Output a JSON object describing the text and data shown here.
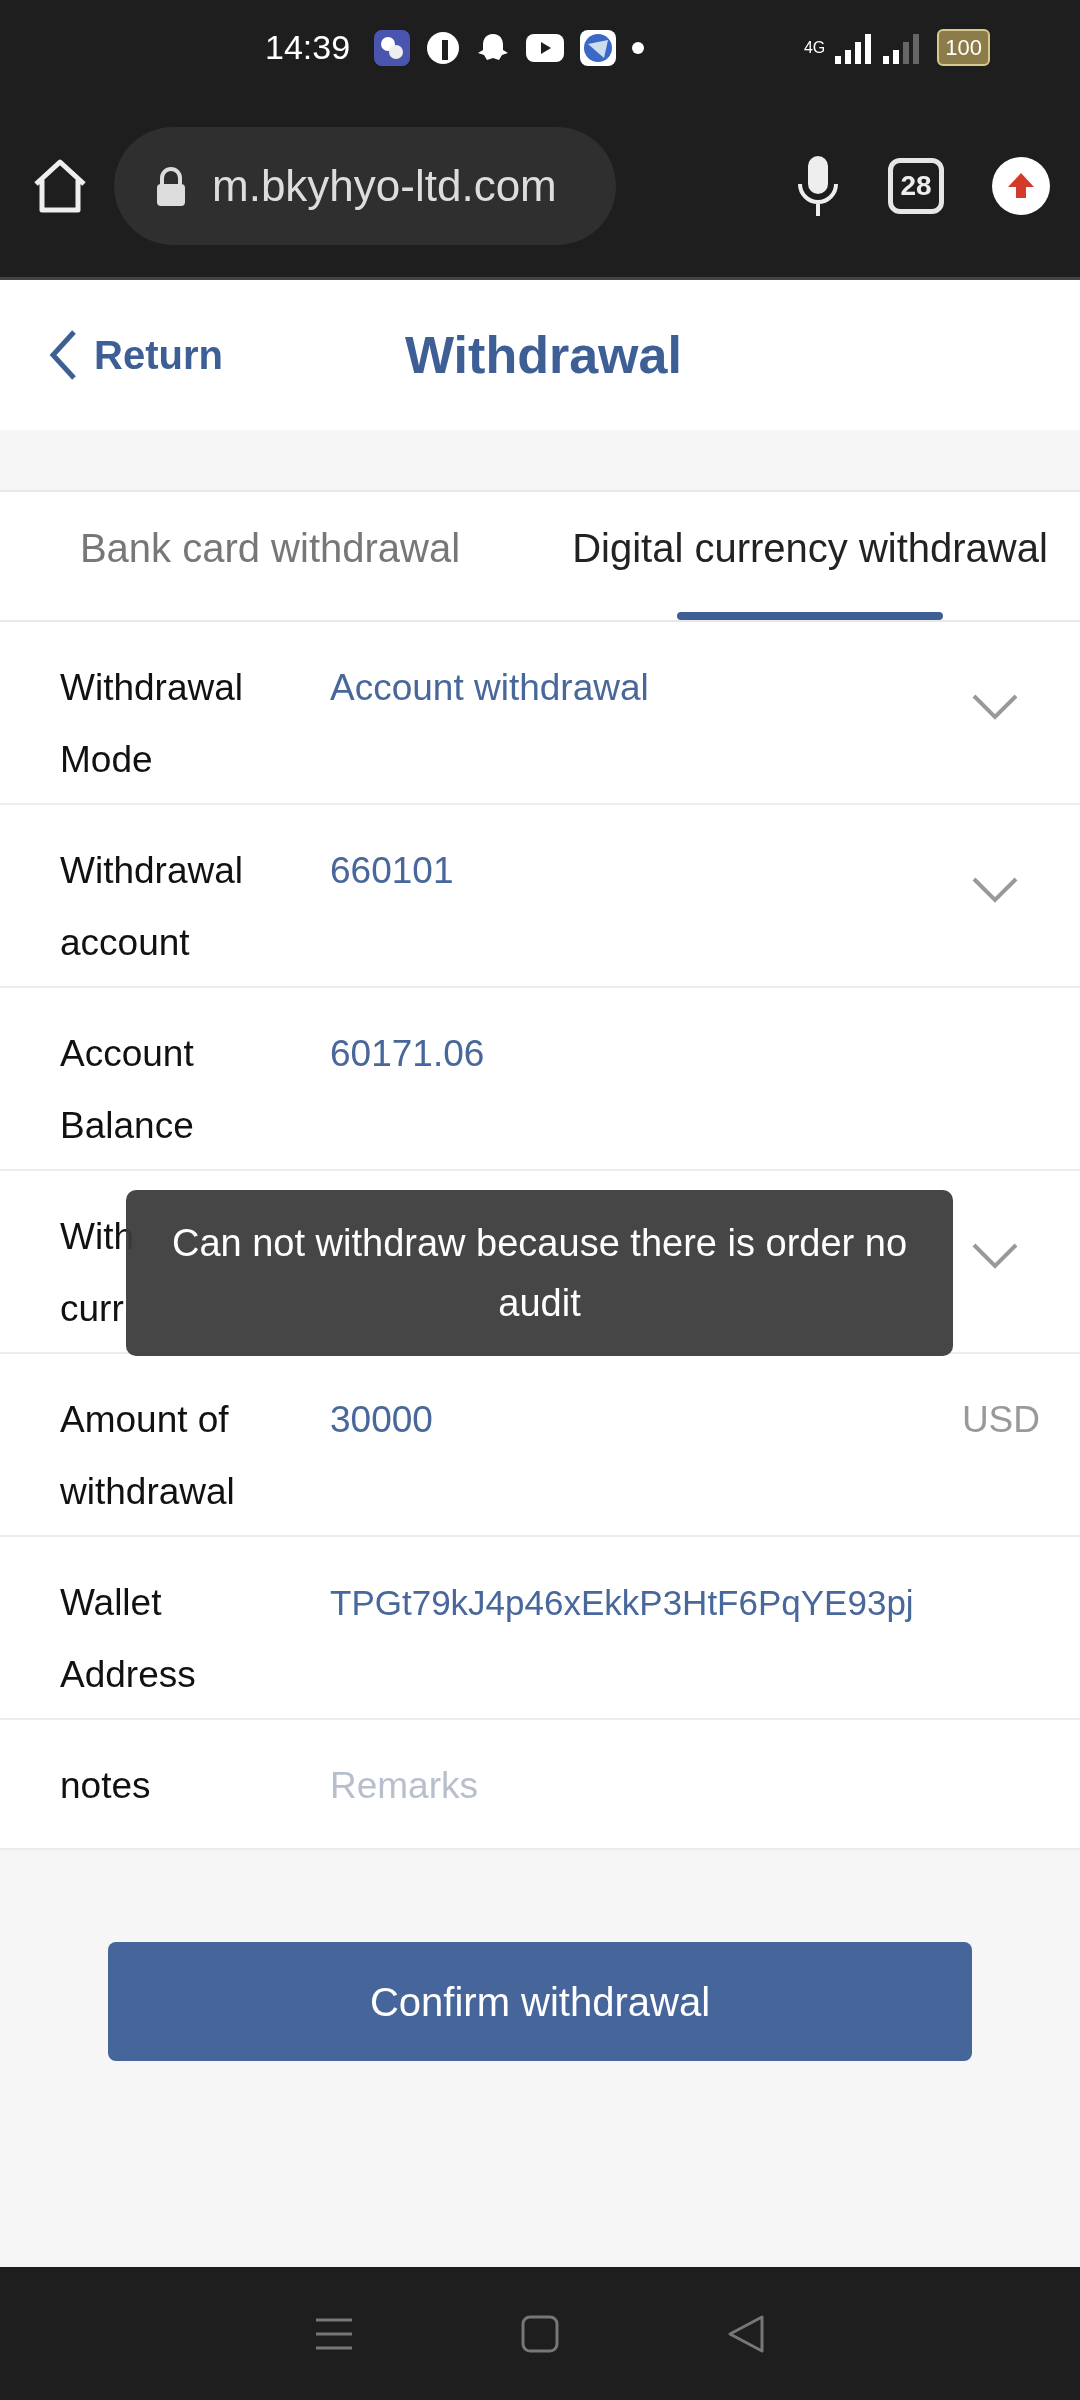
{
  "status_bar": {
    "time": "14:39",
    "network": "4G",
    "battery": "100"
  },
  "browser": {
    "url": "m.bkyhyo-ltd.com",
    "tab_count": "28"
  },
  "header": {
    "back": "Return",
    "title": "Withdrawal"
  },
  "tabs": [
    {
      "label": "Bank card withdrawal",
      "selected": false
    },
    {
      "label": "Digital currency withdrawal",
      "selected": true
    }
  ],
  "fields": [
    {
      "kind": "select",
      "label_lines": [
        "Withdrawal",
        "Mode"
      ],
      "value": "Account withdrawal"
    },
    {
      "kind": "select",
      "label_lines": [
        "Withdrawal",
        "account"
      ],
      "value": "660101"
    },
    {
      "kind": "display",
      "label_lines": [
        "Account",
        "Balance"
      ],
      "value": "60171.06"
    },
    {
      "kind": "select",
      "label_lines": [
        "With",
        "curr"
      ]
    },
    {
      "kind": "display",
      "label_lines": [
        "Amount of",
        "withdrawal"
      ],
      "value": "30000",
      "suffix": "USD"
    },
    {
      "kind": "display",
      "label_lines": [
        "Wallet",
        "Address"
      ],
      "value": "TPGt79kJ4p46xEkkP3HtF6PqYE93pj"
    },
    {
      "kind": "input",
      "label_lines": [
        "notes"
      ],
      "placeholder": "Remarks"
    }
  ],
  "toast": {
    "message": "Can not withdraw because there is order no audit"
  },
  "confirm_button": "Confirm withdrawal"
}
